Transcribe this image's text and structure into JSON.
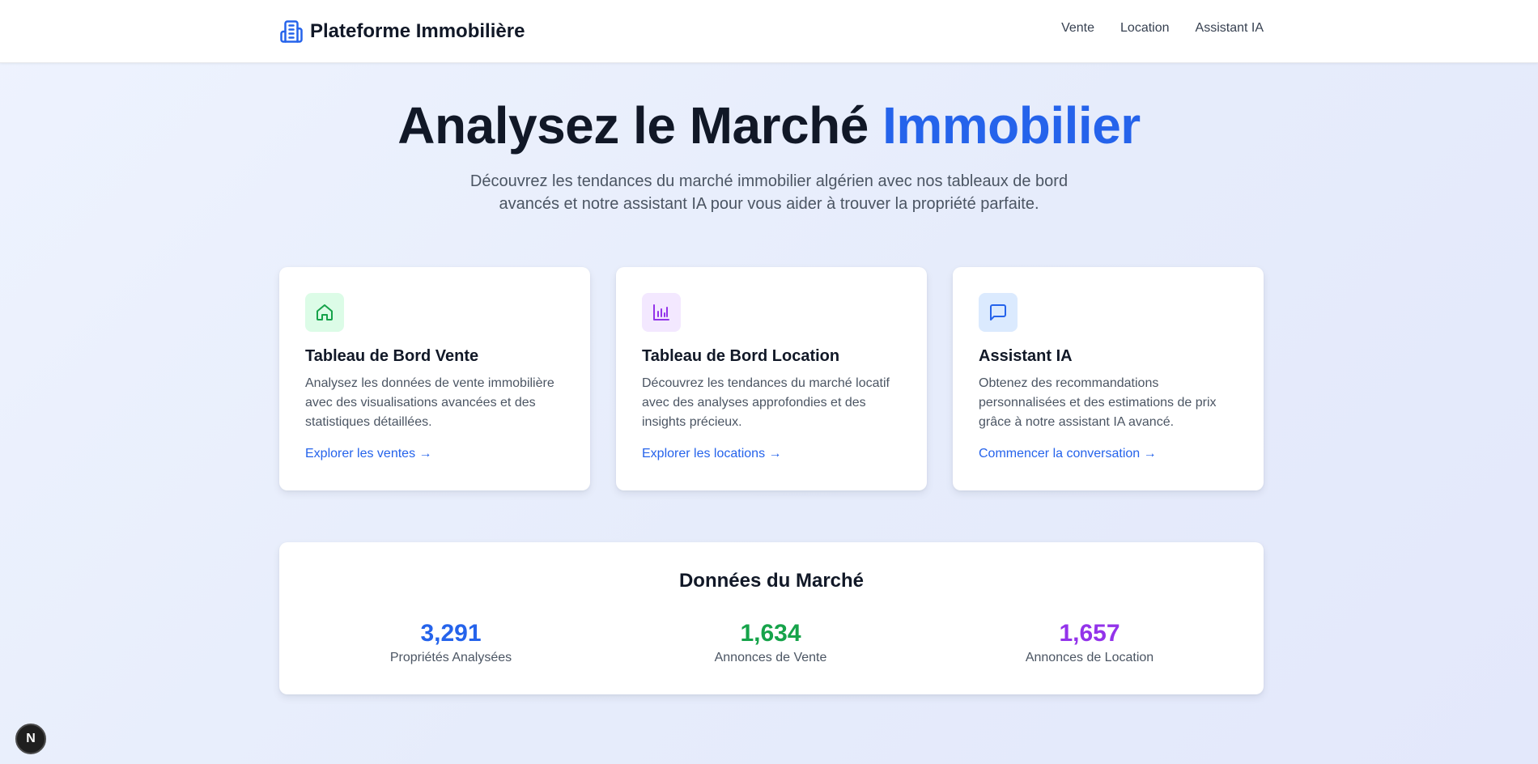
{
  "header": {
    "brand_icon": "building-icon",
    "brand_title": "Plateforme Immobilière",
    "nav": [
      {
        "label": "Vente"
      },
      {
        "label": "Location"
      },
      {
        "label": "Assistant IA"
      }
    ]
  },
  "hero": {
    "title_main": "Analysez le Marché ",
    "title_accent": "Immobilier",
    "subtitle": "Découvrez les tendances du marché immobilier algérien avec nos tableaux de bord avancés et notre assistant IA pour vous aider à trouver la propriété parfaite."
  },
  "cards": [
    {
      "icon": "home-icon",
      "title": "Tableau de Bord Vente",
      "description": "Analysez les données de vente immobilière avec des visualisations avancées et des statistiques détaillées.",
      "link": "Explorer les ventes →"
    },
    {
      "icon": "bar-chart-icon",
      "title": "Tableau de Bord Location",
      "description": "Découvrez les tendances du marché locatif avec des analyses approfondies et des insights précieux.",
      "link": "Explorer les locations →"
    },
    {
      "icon": "message-icon",
      "title": "Assistant IA",
      "description": "Obtenez des recommandations personnalisées et des estimations de prix grâce à notre assistant IA avancé.",
      "link": "Commencer la conversation →"
    }
  ],
  "market": {
    "title": "Données du Marché",
    "stats": [
      {
        "value": "3,291",
        "label": "Propriétés Analysées"
      },
      {
        "value": "1,634",
        "label": "Annonces de Vente"
      },
      {
        "value": "1,657",
        "label": "Annonces de Location"
      }
    ]
  },
  "colors": {
    "accent": "#2563eb",
    "green": "#16a34a",
    "purple": "#9333ea",
    "green_bg": "#dcfce7",
    "purple_bg": "#f3e8ff",
    "blue_bg": "#dbeafe"
  },
  "dev_badge": {
    "letter": "N"
  }
}
